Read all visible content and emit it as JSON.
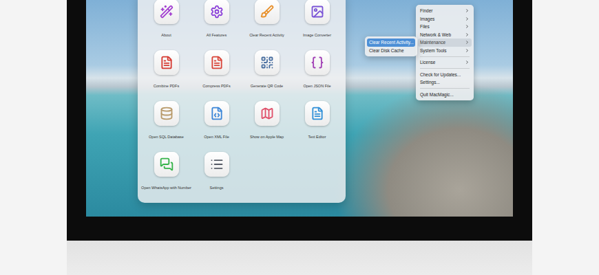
{
  "launcher": {
    "tiles": [
      {
        "label": "About"
      },
      {
        "label": "All Features"
      },
      {
        "label": "Clear Recent Activity"
      },
      {
        "label": "Image Converter"
      },
      {
        "label": "Combine PDFs"
      },
      {
        "label": "Compress PDFs"
      },
      {
        "label": "Generate QR Code"
      },
      {
        "label": "Open JSON File"
      },
      {
        "label": "Open SQL Database"
      },
      {
        "label": "Open XML File"
      },
      {
        "label": "Show on Apple Map"
      },
      {
        "label": "Text Editor"
      },
      {
        "label": "Open WhatsApp with Number"
      },
      {
        "label": "Settings"
      }
    ]
  },
  "menu": {
    "items": [
      {
        "kind": "item",
        "label": "Finder",
        "submenu": true,
        "selected": false
      },
      {
        "kind": "item",
        "label": "Images",
        "submenu": true,
        "selected": false
      },
      {
        "kind": "item",
        "label": "Files",
        "submenu": true,
        "selected": false
      },
      {
        "kind": "item",
        "label": "Network & Web",
        "submenu": true,
        "selected": false
      },
      {
        "kind": "item",
        "label": "Maintenance",
        "submenu": true,
        "selected": true
      },
      {
        "kind": "item",
        "label": "System Tools",
        "submenu": true,
        "selected": false
      },
      {
        "kind": "separator"
      },
      {
        "kind": "item",
        "label": "License",
        "submenu": true,
        "selected": false
      },
      {
        "kind": "separator"
      },
      {
        "kind": "item",
        "label": "Check for Updates...",
        "submenu": false,
        "selected": false
      },
      {
        "kind": "item",
        "label": "Settings...",
        "submenu": false,
        "selected": false
      },
      {
        "kind": "separator"
      },
      {
        "kind": "item",
        "label": "Quit MacMagic...",
        "submenu": false,
        "selected": false
      }
    ]
  },
  "submenu": {
    "items": [
      {
        "label": "Clear Recent Activity...",
        "selected": true
      },
      {
        "label": "Clear Disk Cache",
        "selected": false
      }
    ]
  }
}
